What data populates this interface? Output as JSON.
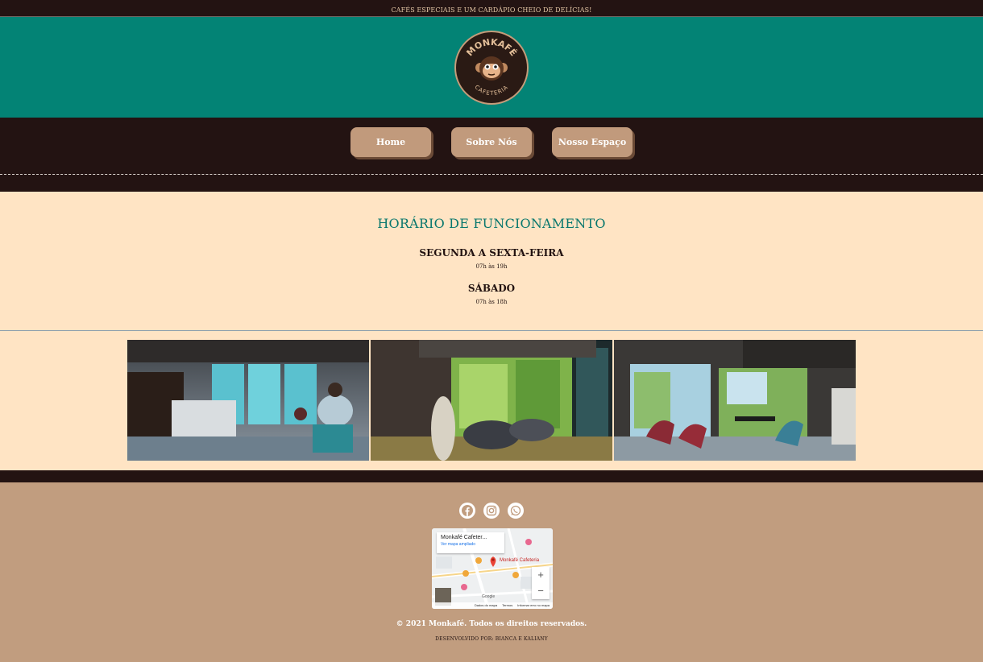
{
  "topbar": {
    "tagline": "CAFÉS ESPECIAIS E UM CARDÁPIO CHEIO DE DELÍCIAS!"
  },
  "logo": {
    "top_text": "MONKAFÉ",
    "bottom_text": "CAFETERIA"
  },
  "nav": {
    "items": [
      {
        "label": "Home"
      },
      {
        "label": "Sobre Nós"
      },
      {
        "label": "Nosso Espaço"
      }
    ]
  },
  "hours": {
    "title": "HORÁRIO DE FUNCIONAMENTO",
    "weekday_label": "SEGUNDA A SEXTA-FEIRA",
    "weekday_time": "07h às 19h",
    "saturday_label": "SÁBADO",
    "saturday_time": "07h às 18h"
  },
  "gallery": {
    "photos": [
      "cafe-interior-counter",
      "cafe-interior-window-chairs",
      "cafe-interior-tables"
    ]
  },
  "footer": {
    "socials": [
      "facebook-icon",
      "instagram-icon",
      "whatsapp-icon"
    ],
    "map": {
      "place_name": "Monkafé Cafeter...",
      "link": "Ver mapa ampliado",
      "pin_label": "Monkafé Cafeteria",
      "zoom_in": "+",
      "zoom_out": "−",
      "attrib_data": "Dados do mapa",
      "attrib_terms": "Termos",
      "attrib_report": "Informar erro no mapa",
      "google": "Google"
    },
    "copyright": "© 2021 Monkafé. Todos os direitos reservados.",
    "developer": "DESENVOLVIDO POR: BIANCA E KALIANY"
  },
  "colors": {
    "dark": "#231312",
    "teal": "#038375",
    "cream": "#ffe4c4",
    "tan": "#c19d7f"
  }
}
